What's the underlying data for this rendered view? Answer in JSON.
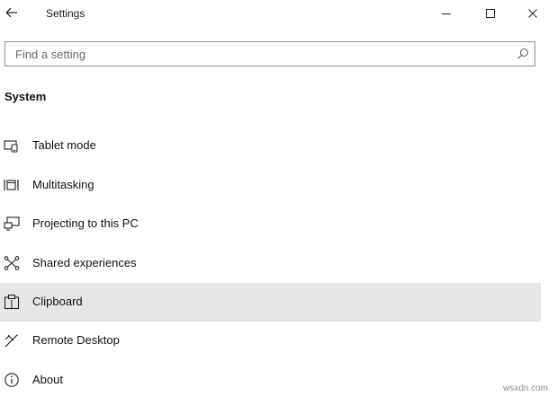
{
  "window": {
    "title": "Settings",
    "controls": {
      "back_icon": "arrow-left-icon",
      "minimize_icon": "minimize-icon",
      "maximize_icon": "maximize-icon",
      "close_icon": "close-icon"
    }
  },
  "search": {
    "placeholder": "Find a setting",
    "value": "",
    "icon": "search-icon"
  },
  "section": {
    "title": "System"
  },
  "nav": {
    "items": [
      {
        "label": "Tablet mode",
        "icon": "tablet-mode-icon",
        "selected": false
      },
      {
        "label": "Multitasking",
        "icon": "multitasking-icon",
        "selected": false
      },
      {
        "label": "Projecting to this PC",
        "icon": "projecting-icon",
        "selected": false
      },
      {
        "label": "Shared experiences",
        "icon": "shared-experiences-icon",
        "selected": false
      },
      {
        "label": "Clipboard",
        "icon": "clipboard-icon",
        "selected": true
      },
      {
        "label": "Remote Desktop",
        "icon": "remote-desktop-icon",
        "selected": false
      },
      {
        "label": "About",
        "icon": "info-icon",
        "selected": false
      }
    ]
  },
  "watermark": "wsxdn.com",
  "colors": {
    "selected_background": "#e6e6e6",
    "search_border": "#8a8a8a"
  }
}
